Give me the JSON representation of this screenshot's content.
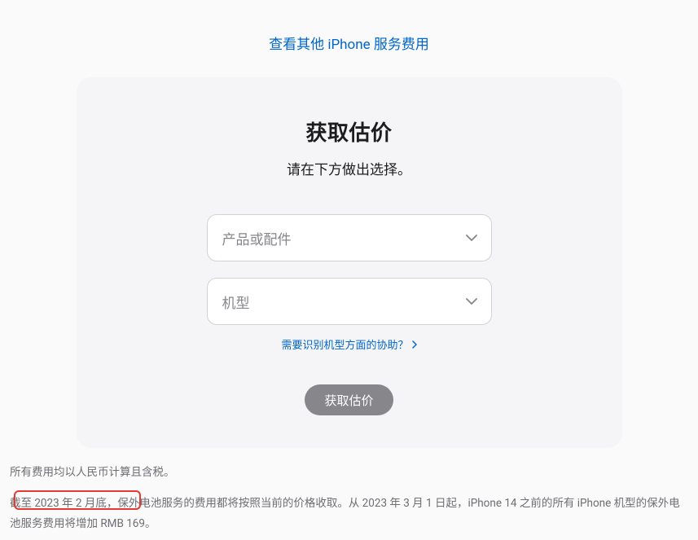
{
  "topLink": "查看其他 iPhone 服务费用",
  "card": {
    "title": "获取估价",
    "subtitle": "请在下方做出选择。",
    "select1Placeholder": "产品或配件",
    "select2Placeholder": "机型",
    "helpLink": "需要识别机型方面的协助？",
    "submitLabel": "获取估价"
  },
  "footnote1": "所有费用均以人民币计算且含税。",
  "footnote2": "截至 2023 年 2 月底，保外电池服务的费用都将按照当前的价格收取。从 2023 年 3 月 1 日起，iPhone 14 之前的所有 iPhone 机型的保外电池服务费用将增加 RMB 169。"
}
